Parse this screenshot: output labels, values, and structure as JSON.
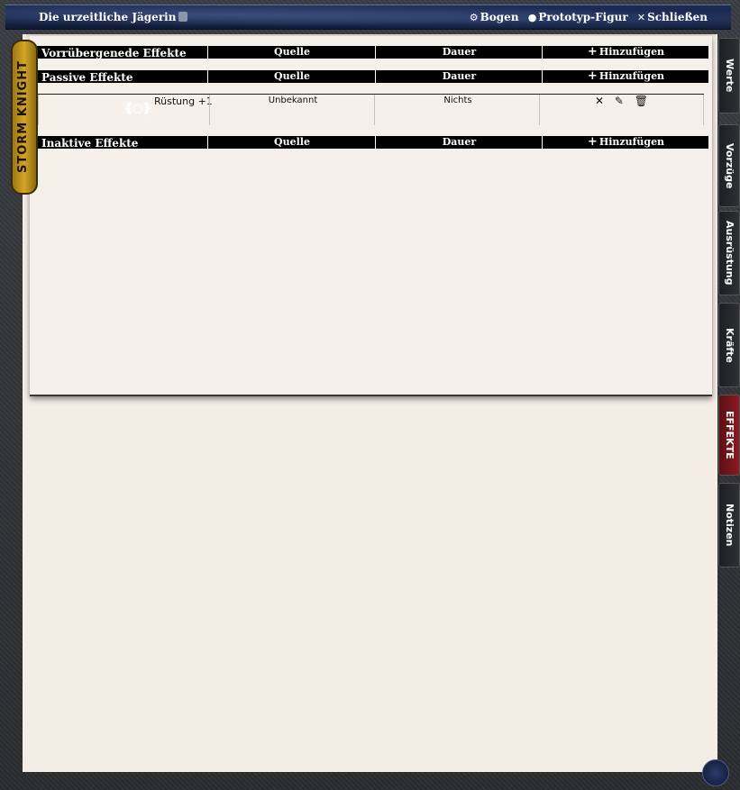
{
  "window": {
    "title": "Die urzeitliche Jägerin",
    "controls": [
      {
        "icon": "gear-icon",
        "label": "Bogen"
      },
      {
        "icon": "user-circle-icon",
        "label": "Prototyp-Figur"
      },
      {
        "icon": "close-icon",
        "label": "Schließen"
      }
    ]
  },
  "badge": {
    "label": "STORM KNIGHT"
  },
  "sections": [
    {
      "name": "Vorrübergenede Effekte",
      "col_source": "Quelle",
      "col_duration": "Dauer",
      "add_label": "Hinzufügen",
      "rows": []
    },
    {
      "name": "Passive Effekte",
      "col_source": "Quelle",
      "col_duration": "Dauer",
      "add_label": "Hinzufügen",
      "rows": [
        {
          "name": "Rüstung +1",
          "source": "Unbekannt",
          "duration": "Nichts"
        }
      ]
    },
    {
      "name": "Inaktive Effekte",
      "col_source": "Quelle",
      "col_duration": "Dauer",
      "add_label": "Hinzufügen",
      "rows": []
    }
  ],
  "tabs": [
    {
      "label": "Werte",
      "active": false
    },
    {
      "label": "Vorzüge",
      "active": false
    },
    {
      "label": "Ausrüstung",
      "active": false
    },
    {
      "label": "Kräfte",
      "active": false
    },
    {
      "label": "EFFEKTE",
      "active": true
    },
    {
      "label": "Notizen",
      "active": false
    }
  ],
  "colors": {
    "active_tab": "#8a1a20",
    "header_bg": "#000000",
    "parchment": "#f3ede5"
  }
}
